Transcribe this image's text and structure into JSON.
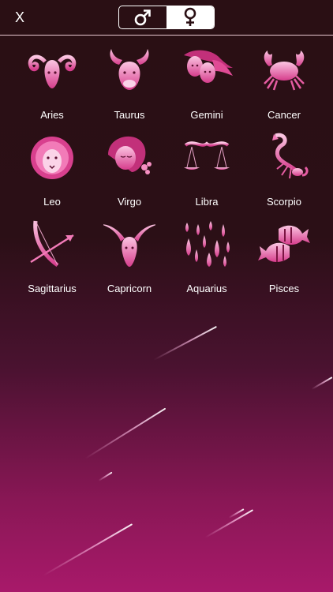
{
  "header": {
    "close_label": "X",
    "gender_options": [
      {
        "symbol": "♂",
        "selected": false
      },
      {
        "symbol": "♀",
        "selected": true
      }
    ]
  },
  "signs": [
    {
      "name": "Aries",
      "icon": "aries-icon"
    },
    {
      "name": "Taurus",
      "icon": "taurus-icon"
    },
    {
      "name": "Gemini",
      "icon": "gemini-icon"
    },
    {
      "name": "Cancer",
      "icon": "cancer-icon"
    },
    {
      "name": "Leo",
      "icon": "leo-icon"
    },
    {
      "name": "Virgo",
      "icon": "virgo-icon"
    },
    {
      "name": "Libra",
      "icon": "libra-icon"
    },
    {
      "name": "Scorpio",
      "icon": "scorpio-icon"
    },
    {
      "name": "Sagittarius",
      "icon": "sagittarius-icon"
    },
    {
      "name": "Capricorn",
      "icon": "capricorn-icon"
    },
    {
      "name": "Aquarius",
      "icon": "aquarius-icon"
    },
    {
      "name": "Pisces",
      "icon": "pisces-icon"
    }
  ],
  "colors": {
    "accent": "#e85aa6",
    "accent_light": "#f7a9d2",
    "background_top": "#2a0f14",
    "background_bottom": "#a8196a"
  }
}
